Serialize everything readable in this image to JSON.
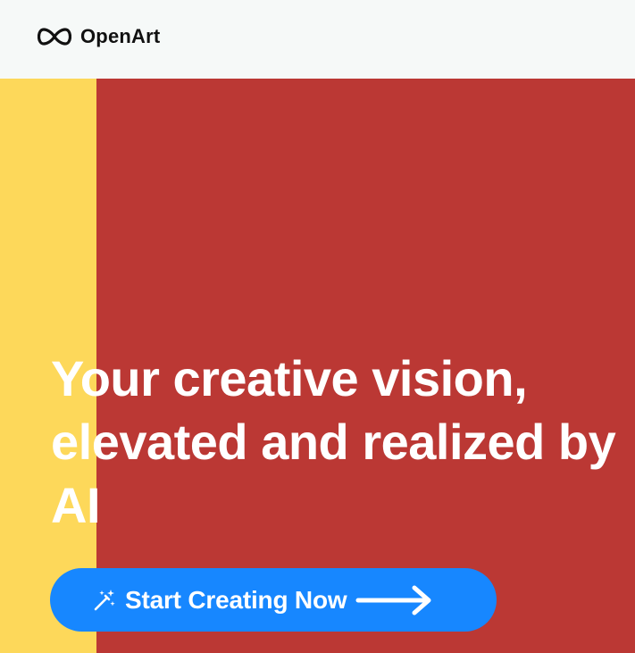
{
  "header": {
    "brand": "OpenArt",
    "logo_icon": "infinity-icon",
    "background": "#f6f9f8"
  },
  "hero": {
    "headline": "Your creative vision, elevated and realized by AI",
    "background": "#bb3834",
    "stripe_color": "#fdd85a",
    "cta": {
      "label": "Start Creating Now",
      "icon": "magic-wand-icon",
      "trailing_icon": "arrow-right-icon",
      "color": "#1787ff"
    }
  }
}
